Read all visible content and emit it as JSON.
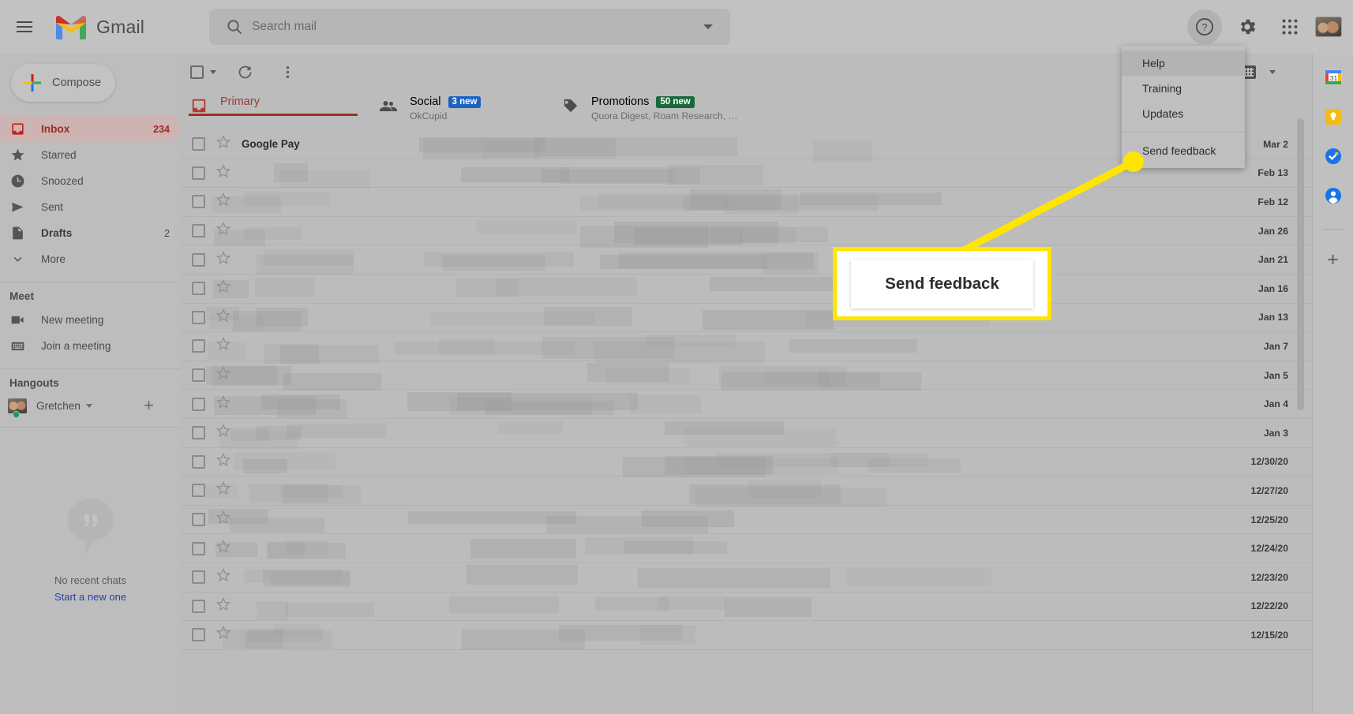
{
  "app": {
    "name": "Gmail"
  },
  "header": {
    "menu_icon": "hamburger-icon",
    "brand": "Gmail",
    "search": {
      "placeholder": "Search mail",
      "value": ""
    },
    "icons": [
      "help-icon",
      "settings-gear-icon",
      "google-apps-grid-icon",
      "account-avatar"
    ]
  },
  "sidebar": {
    "compose_label": "Compose",
    "items": [
      {
        "label": "Inbox",
        "count": "234",
        "icon": "inbox-icon",
        "selected": true,
        "bold": true
      },
      {
        "label": "Starred",
        "count": "",
        "icon": "star-icon",
        "selected": false,
        "bold": false
      },
      {
        "label": "Snoozed",
        "count": "",
        "icon": "clock-icon",
        "selected": false,
        "bold": false
      },
      {
        "label": "Sent",
        "count": "",
        "icon": "send-icon",
        "selected": false,
        "bold": false
      },
      {
        "label": "Drafts",
        "count": "2",
        "icon": "draft-icon",
        "selected": false,
        "bold": true
      },
      {
        "label": "More",
        "count": "",
        "icon": "chevron-down-icon",
        "selected": false,
        "bold": false
      }
    ],
    "meet": {
      "title": "Meet",
      "items": [
        {
          "label": "New meeting",
          "icon": "video-camera-icon"
        },
        {
          "label": "Join a meeting",
          "icon": "keyboard-icon"
        }
      ]
    },
    "hangouts": {
      "title": "Hangouts",
      "user": "Gretchen",
      "status": "online",
      "add_icon": "plus-icon",
      "empty_text": "No recent chats",
      "empty_link": "Start a new one"
    }
  },
  "toolbar": {
    "select_all_icon": "checkbox-icon",
    "refresh_icon": "refresh-icon",
    "more_icon": "more-vertical-icon",
    "keyboard_icon": "keyboard-input-tools-icon"
  },
  "tabs": [
    {
      "label": "Primary",
      "icon": "inbox-tab-icon",
      "sub": "",
      "badge": "",
      "badge_color": "",
      "active": true
    },
    {
      "label": "Social",
      "icon": "people-tab-icon",
      "sub": "OkCupid",
      "badge": "3 new",
      "badge_color": "#1a63c4",
      "active": false
    },
    {
      "label": "Promotions",
      "icon": "tag-tab-icon",
      "sub": "Quora Digest, Roam Research, …",
      "badge": "50 new",
      "badge_color": "#17693a",
      "active": false
    }
  ],
  "list": {
    "rows": [
      {
        "sender": "Google Pay",
        "date": "Mar 2",
        "redacted": false
      },
      {
        "sender": "",
        "date": "Feb 13",
        "redacted": true
      },
      {
        "sender": "",
        "date": "Feb 12",
        "redacted": true
      },
      {
        "sender": "",
        "date": "Jan 26",
        "redacted": true
      },
      {
        "sender": "",
        "date": "Jan 21",
        "redacted": true
      },
      {
        "sender": "",
        "date": "Jan 16",
        "redacted": true
      },
      {
        "sender": "",
        "date": "Jan 13",
        "redacted": true
      },
      {
        "sender": "",
        "date": "Jan 7",
        "redacted": true
      },
      {
        "sender": "",
        "date": "Jan 5",
        "redacted": true
      },
      {
        "sender": "",
        "date": "Jan 4",
        "redacted": true
      },
      {
        "sender": "",
        "date": "Jan 3",
        "redacted": true
      },
      {
        "sender": "",
        "date": "12/30/20",
        "redacted": true
      },
      {
        "sender": "",
        "date": "12/27/20",
        "redacted": true
      },
      {
        "sender": "",
        "date": "12/25/20",
        "redacted": true
      },
      {
        "sender": "",
        "date": "12/24/20",
        "redacted": true
      },
      {
        "sender": "",
        "date": "12/23/20",
        "redacted": true
      },
      {
        "sender": "",
        "date": "12/22/20",
        "redacted": true
      },
      {
        "sender": "",
        "date": "12/15/20",
        "redacted": true
      }
    ]
  },
  "help_menu": {
    "items": [
      {
        "label": "Help",
        "hover": true
      },
      {
        "label": "Training",
        "hover": false
      },
      {
        "label": "Updates",
        "hover": false
      }
    ],
    "footer": {
      "label": "Send feedback"
    }
  },
  "callout": {
    "text": "Send feedback",
    "highlight_color": "#ffe500"
  },
  "right_rail": {
    "icons": [
      "google-calendar-icon",
      "google-keep-icon",
      "google-tasks-icon",
      "google-contacts-icon",
      "add-ons-plus-icon"
    ]
  }
}
